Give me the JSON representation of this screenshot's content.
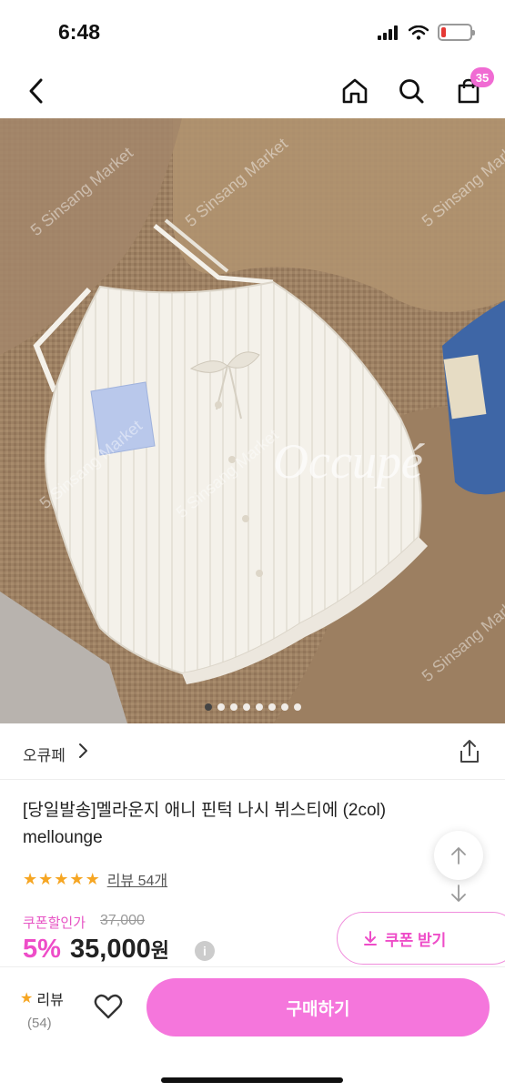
{
  "status": {
    "time": "6:48",
    "battery_level": 0.15,
    "battery_color": "#e53935"
  },
  "nav": {
    "back_icon": "chevron-left-icon",
    "home_icon": "home-icon",
    "search_icon": "search-icon",
    "cart_icon": "shopping-bag-icon",
    "cart_count": "35"
  },
  "image": {
    "watermark_brand": "Occupé",
    "watermark_market": "5 Sinsang Market",
    "slide_count": 8,
    "active_slide": 0
  },
  "brand": {
    "name": "오큐페",
    "share_icon": "share-icon"
  },
  "product": {
    "title": "[당일발송]멜라운지 애니 핀턱 나시 뷔스티에 (2col) mellounge",
    "rating": 5,
    "review_link": "리뷰 54개"
  },
  "price": {
    "coupon_label": "쿠폰할인가",
    "original": "37,000",
    "discount": "5%",
    "sale": "35,000",
    "currency": "원",
    "info": "i"
  },
  "coupon_button": {
    "label": "쿠폰 받기"
  },
  "bottom": {
    "review_label": "리뷰",
    "review_count": "(54)",
    "buy_label": "구매하기"
  },
  "colors": {
    "accent": "#f576dc",
    "accent_text": "#ee4dc8",
    "star": "#f6a623"
  }
}
